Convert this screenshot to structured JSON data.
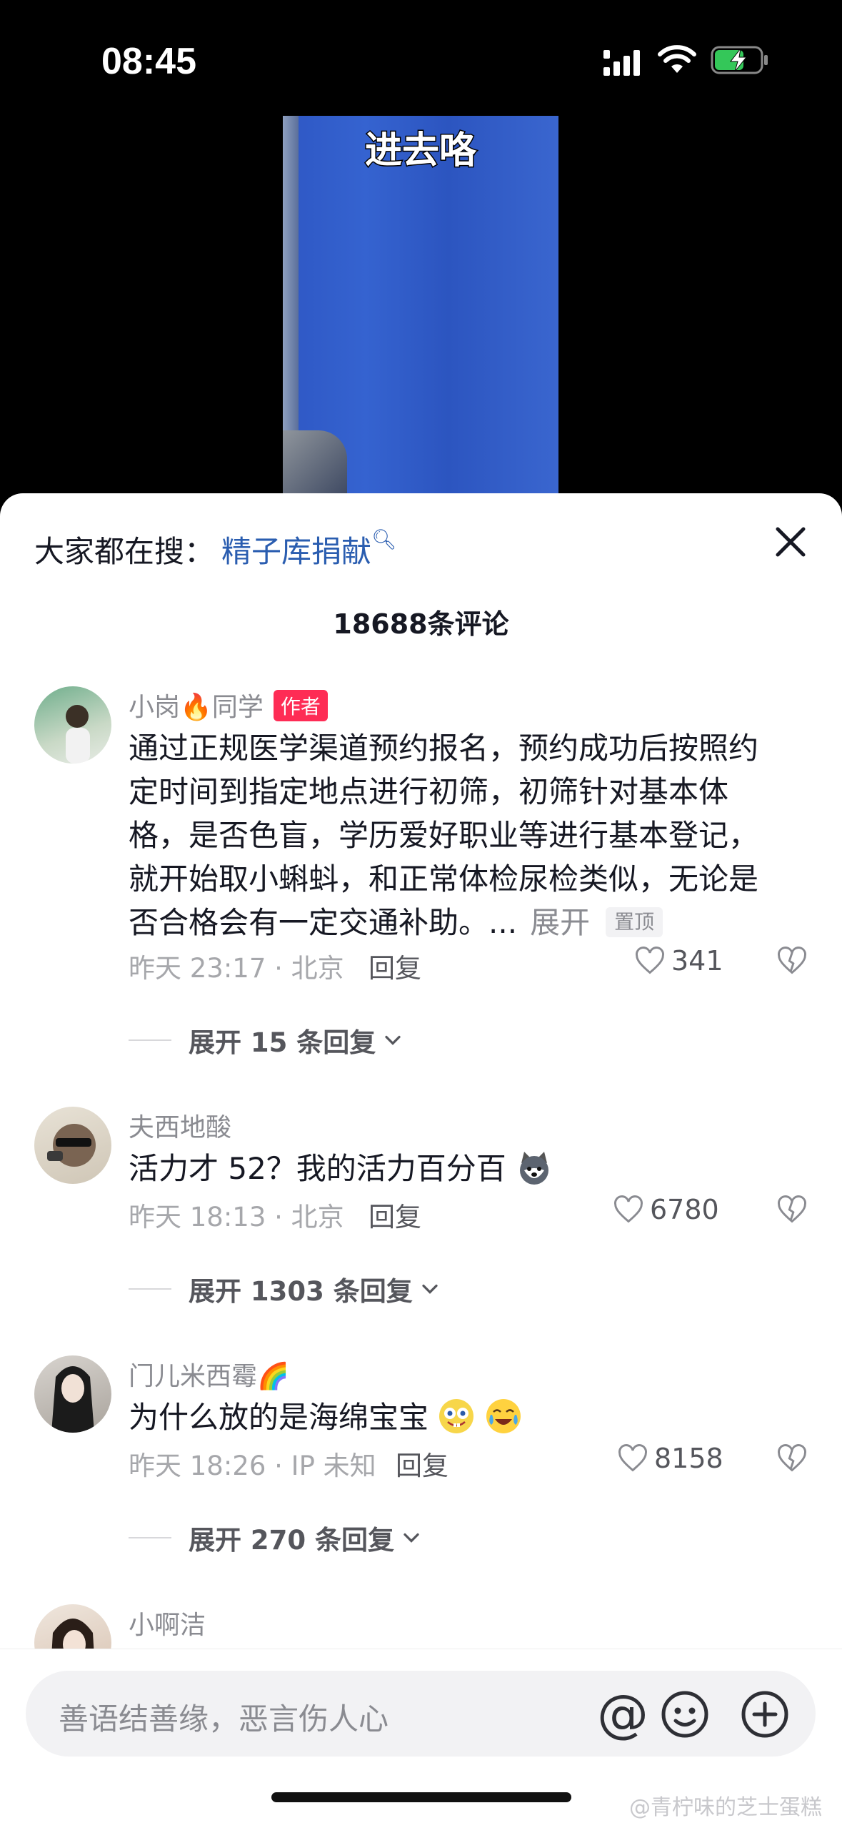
{
  "status_bar": {
    "time": "08:45"
  },
  "video": {
    "caption": "进去咯"
  },
  "search": {
    "label": "大家都在搜：",
    "keyword": "精子库捐献",
    "icon": "search-icon"
  },
  "comments_count": "18688条评论",
  "comments": [
    {
      "user": "小岗",
      "user_suffix": "同学",
      "badge": "作者",
      "text": "通过正规医学渠道预约报名，预约成功后按照约定时间到指定地点进行初筛，初筛针对基本体格，是否色盲，学历爱好职业等进行基本登记，就开始取小蝌蚪，和正常体检尿检类似，无论是否合格会有一定交通补助。...",
      "expand": "展开",
      "pinned": "置顶",
      "time": "昨天 23:17 · 北京",
      "reply": "回复",
      "likes": "341",
      "expand_replies": "展开 15 条回复"
    },
    {
      "user": "夫西地酸",
      "text": "活力才 52？我的活力百分百",
      "time": "昨天 18:13 · 北京",
      "reply": "回复",
      "likes": "6780",
      "expand_replies": "展开 1303 条回复"
    },
    {
      "user": "门儿米西霉",
      "text": "为什么放的是海绵宝宝",
      "time": "昨天 18:26 · IP 未知",
      "reply": "回复",
      "likes": "8158",
      "expand_replies": "展开 270 条回复"
    },
    {
      "user": "小啊洁"
    }
  ],
  "input": {
    "placeholder": "善语结善缘，恶言伤人心"
  },
  "watermark": "@青柠味的芝士蛋糕"
}
